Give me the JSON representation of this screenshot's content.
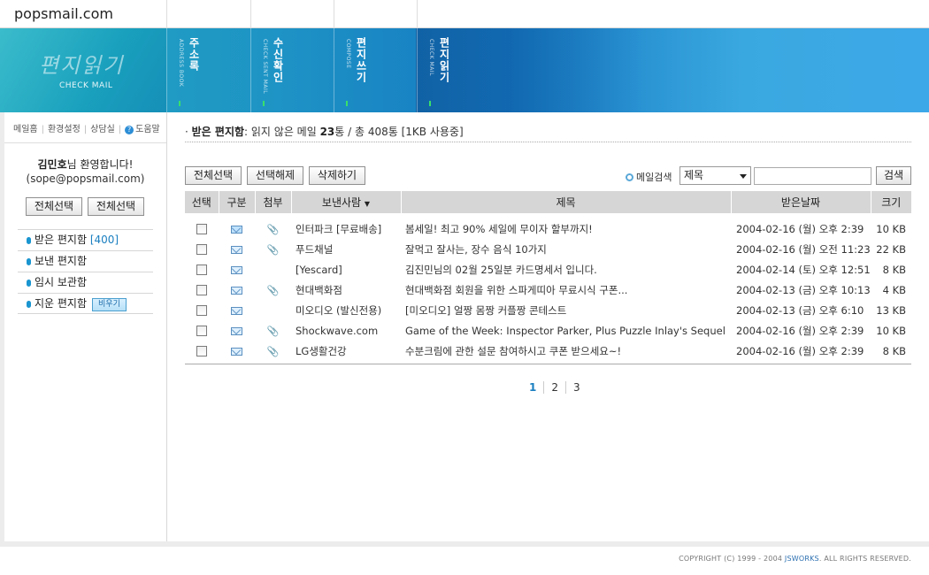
{
  "site": "popsmail.com",
  "logo": {
    "kr": "편지읽기",
    "en": "CHECK MAIL"
  },
  "nav": [
    {
      "kr": "주소록",
      "sub": "ADDRESS BOOK"
    },
    {
      "kr": "수신확인",
      "sub": "CHECK SENT MAIL"
    },
    {
      "kr": "편지쓰기",
      "sub": "COMPOSE"
    },
    {
      "kr": "편지읽기",
      "sub": "CHECK MAIL"
    }
  ],
  "util_links": [
    "메일홈",
    "환경설정",
    "상담실",
    "도움말"
  ],
  "user": {
    "name": "김민호",
    "greeting": "님 환영합니다!",
    "email": "(sope@popsmail.com)"
  },
  "left_buttons": [
    "전체선택",
    "전체선택"
  ],
  "folders": [
    {
      "label": "받은 편지함",
      "count": "[400]"
    },
    {
      "label": "보낸 편지함"
    },
    {
      "label": "임시 보관함"
    },
    {
      "label": "지운 편지함",
      "action": "비우기"
    }
  ],
  "mailbox": {
    "title": "받은 편지함",
    "summary_pre": ": 읽지 않은 메일 ",
    "unread": "23",
    "summary_mid": "통 / 총 408통 [1KB 사용중]"
  },
  "toolbar": {
    "select_all": "전체선택",
    "deselect": "선택해제",
    "delete": "삭제하기"
  },
  "search": {
    "label": "메일검색",
    "field": "제목",
    "input_value": "",
    "button": "검색"
  },
  "columns": [
    "선택",
    "구분",
    "첨부",
    "보낸사람",
    "제목",
    "받은날짜",
    "크기"
  ],
  "rows": [
    {
      "unread": true,
      "attach": true,
      "from": "인터파크 [무료배송]",
      "subject": "봄세일! 최고 90% 세일에 무이자 할부까지!",
      "date": "2004-02-16 (월) 오후 2:39",
      "size": "10 KB"
    },
    {
      "unread": false,
      "attach": true,
      "from": "푸드채널",
      "subject": "잘먹고 잘사는, 장수 음식 10가지",
      "date": "2004-02-16 (월) 오전 11:23",
      "size": "22 KB"
    },
    {
      "unread": false,
      "attach": false,
      "from": "[Yescard]",
      "subject": "김진민님의 02월 25일분 카드명세서 입니다.",
      "date": "2004-02-14 (토) 오후 12:51",
      "size": "8 KB"
    },
    {
      "unread": false,
      "attach": true,
      "from": "현대백화점",
      "subject": "현대백화점 회원을 위한 스파게띠아 무료시식 구폰...",
      "date": "2004-02-13 (금) 오후 10:13",
      "size": "4 KB"
    },
    {
      "unread": false,
      "attach": false,
      "from": "미오디오 (발신전용)",
      "subject": "[미오디오] 얼짱 몸짱 커플짱 콘테스트",
      "date": "2004-02-13 (금) 오후 6:10",
      "size": "13 KB"
    },
    {
      "unread": false,
      "attach": true,
      "from": "Shockwave.com",
      "subject": "Game of the Week: Inspector Parker, Plus Puzzle Inlay's Sequel",
      "date": "2004-02-16 (월) 오후 2:39",
      "size": "10 KB"
    },
    {
      "unread": false,
      "attach": true,
      "from": "LG생활건강",
      "subject": "수분크림에 관한 설문 참여하시고 쿠폰 받으세요~!",
      "date": "2004-02-16 (월) 오후 2:39",
      "size": "8 KB"
    }
  ],
  "pages": [
    "1",
    "2",
    "3"
  ],
  "footer": {
    "copy": "COPYRIGHT (C) 1999 - 2004 ",
    "brand": "JSWORKS",
    "rights": ". ALL RIGHTS RESERVED."
  },
  "colors": {
    "banner": "#1e93c5",
    "accent": "#1a7fc0",
    "header_bg": "#d6d6d6"
  }
}
